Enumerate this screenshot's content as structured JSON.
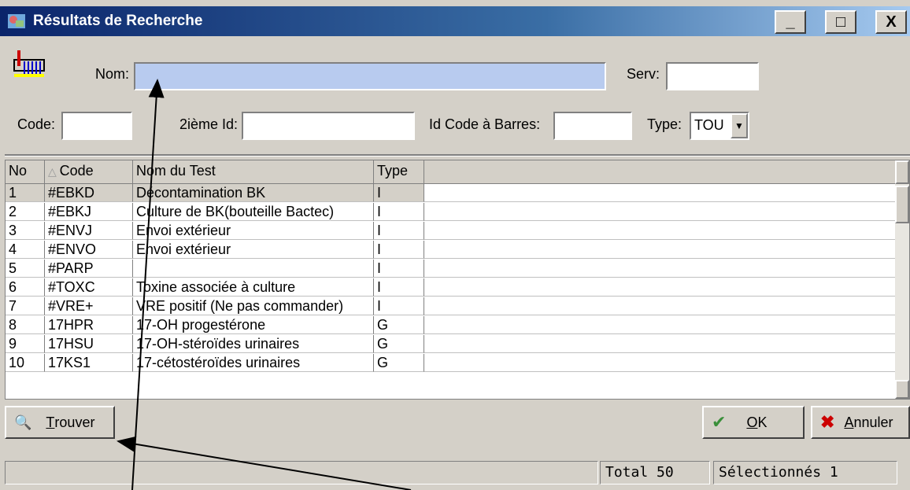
{
  "window": {
    "title": "Résultats de Recherche",
    "min_label": "_",
    "max_label": "□",
    "close_label": "X"
  },
  "form": {
    "nom_label": "Nom:",
    "nom_value": "",
    "serv_label": "Serv:",
    "serv_value": "",
    "code_label": "Code:",
    "code_value": "",
    "id2_label": "2ième Id:",
    "id2_value": "",
    "barcode_label": "Id Code à Barres:",
    "barcode_value": "",
    "type_label": "Type:",
    "type_value": "TOU"
  },
  "grid": {
    "columns": [
      "No",
      "Code",
      "Nom du Test",
      "Type"
    ],
    "rows": [
      [
        "1",
        "#EBKD",
        "Décontamination BK",
        "I"
      ],
      [
        "2",
        "#EBKJ",
        "Culture de BK(bouteille Bactec)",
        "I"
      ],
      [
        "3",
        "#ENVJ",
        "Envoi extérieur",
        "I"
      ],
      [
        "4",
        "#ENVO",
        "Envoi extérieur",
        "I"
      ],
      [
        "5",
        "#PARP",
        "",
        "I"
      ],
      [
        "6",
        "#TOXC",
        " Toxine associée à culture",
        "I"
      ],
      [
        "7",
        "#VRE+",
        "VRE positif (Ne pas commander)",
        "I"
      ],
      [
        "8",
        "17HPR",
        "17-OH progestérone",
        "G"
      ],
      [
        "9",
        "17HSU",
        "17-OH-stéroïdes urinaires",
        "G"
      ],
      [
        "10",
        "17KS1",
        "17-cétostéroïdes urinaires",
        "G"
      ]
    ]
  },
  "buttons": {
    "find_hotkey": "T",
    "find_rest": "rouver",
    "ok_hotkey": "O",
    "ok_rest": "K",
    "cancel_hotkey": "A",
    "cancel_rest": "nnuler"
  },
  "status": {
    "total": "Total 50",
    "selected": "Sélectionnés 1"
  },
  "colors": {
    "titlebar": "#0a246a",
    "nom_field": "#b8cbef",
    "selected_row": "#d4d0c8"
  }
}
